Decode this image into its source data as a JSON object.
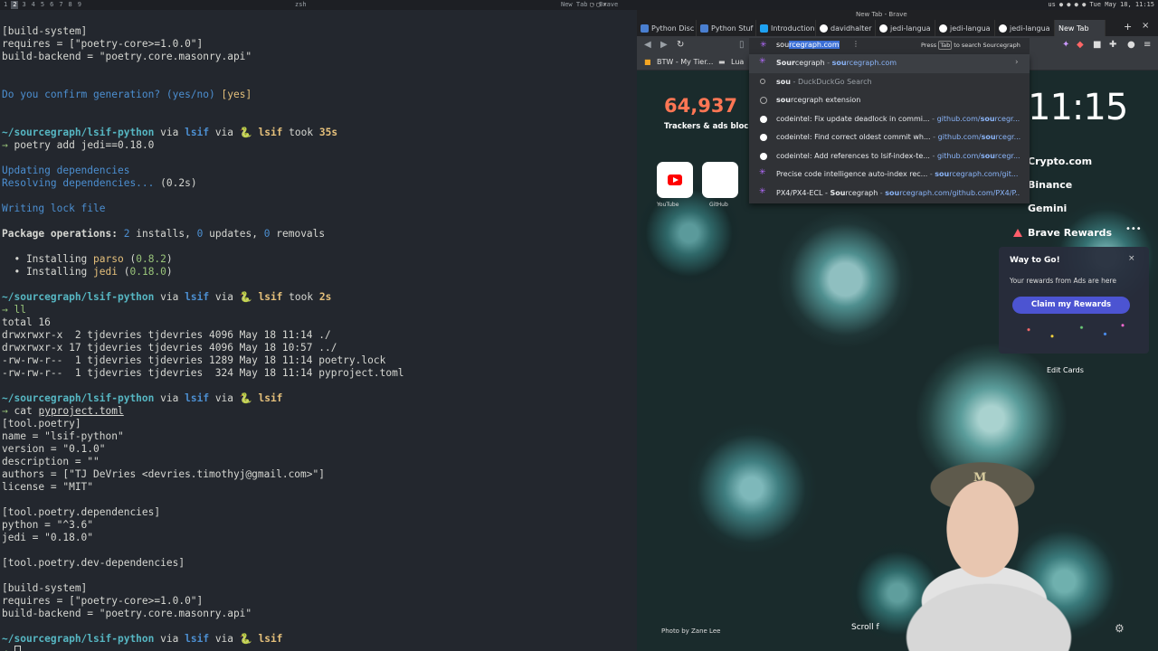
{
  "topbar": {
    "workspaces": [
      "1",
      "2",
      "3",
      "4",
      "5",
      "6",
      "7",
      "8",
      "9"
    ],
    "active_workspace": "2",
    "terminal_title": "zsh",
    "browser_window_title": "New Tab - Brave",
    "tray_region": "us",
    "datetime": "Tue May 18, 11:15"
  },
  "terminal": {
    "prompt": {
      "path": "~/sourcegraph/lsif-python",
      "via": "via",
      "branch_word": "lsif",
      "env_icon": "🐍",
      "env_name": "lsif"
    },
    "lines": [
      "[build-system]",
      "requires = [\"poetry-core>=1.0.0\"]",
      "build-backend = \"poetry.core.masonry.api\"",
      "",
      "",
      "Do you confirm generation? (yes/no) [yes]",
      "",
      "",
      "",
      "poetry add jedi==0.18.0",
      "",
      "Updating dependencies",
      "Resolving dependencies... (0.2s)",
      "",
      "Writing lock file",
      "",
      "Package operations: 2 installs, 0 updates, 0 removals",
      "",
      "  • Installing parso (0.8.2)",
      "  • Installing jedi (0.18.0)",
      "",
      "",
      "ll",
      "total 16",
      "drwxrwxr-x  2 tjdevries tjdevries 4096 May 18 11:14 ./",
      "drwxrwxr-x 17 tjdevries tjdevries 4096 May 18 10:57 ../",
      "-rw-rw-r--  1 tjdevries tjdevries 1289 May 18 11:14 poetry.lock",
      "-rw-rw-r--  1 tjdevries tjdevries  324 May 18 11:14 pyproject.toml",
      "",
      "",
      "cat pyproject.toml",
      "[tool.poetry]",
      "name = \"lsif-python\"",
      "version = \"0.1.0\"",
      "description = \"\"",
      "authors = [\"TJ DeVries <devries.timothyj@gmail.com>\"]",
      "license = \"MIT\"",
      "",
      "[tool.poetry.dependencies]",
      "python = \"^3.6\"",
      "jedi = \"0.18.0\"",
      "",
      "[tool.poetry.dev-dependencies]",
      "",
      "[build-system]",
      "requires = [\"poetry-core>=1.0.0\"]",
      "build-backend = \"poetry.core.masonry.api\"",
      "",
      ""
    ],
    "prompt1_took": "took",
    "prompt1_duration": "35s",
    "prompt2_took": "took",
    "prompt2_duration": "2s",
    "arrow": "→",
    "confirm_q": "Do you confirm generation? (yes/no)",
    "confirm_a": "[yes]",
    "cmd_poetry": "poetry add jedi==0.18.0",
    "updating": "Updating dependencies",
    "resolving": "Resolving dependencies...",
    "resolving_time": "(0.2s)",
    "writing": "Writing lock file",
    "pkg_ops_label": "Package operations:",
    "pkg_installs_n": "2",
    "pkg_installs_word": "installs,",
    "pkg_updates_n": "0",
    "pkg_updates_word": "updates,",
    "pkg_removals_n": "0",
    "pkg_removals_word": "removals",
    "install1_prefix": "  • Installing",
    "install1_pkg": "parso",
    "install1_ver": "0.8.2",
    "install2_prefix": "  • Installing",
    "install2_pkg": "jedi",
    "install2_ver": "0.18.0",
    "cmd_ll": "ll",
    "cmd_cat": "cat",
    "cat_file": "pyproject.toml"
  },
  "browser": {
    "tabs": [
      {
        "label": "Python Disc",
        "icon": "python-icon"
      },
      {
        "label": "Python Stuf",
        "icon": "python-icon"
      },
      {
        "label": "Introduction",
        "icon": "mdn-icon"
      },
      {
        "label": "davidhalter",
        "icon": "github-icon"
      },
      {
        "label": "jedi-langua",
        "icon": "github-icon"
      },
      {
        "label": "jedi-langua",
        "icon": "github-icon"
      },
      {
        "label": "jedi-langua",
        "icon": "github-icon"
      },
      {
        "label": "New Tab",
        "icon": "brave-icon",
        "active": true
      }
    ],
    "new_tab_symbol": "+",
    "close_symbol": "×",
    "bookmarks": [
      {
        "label": "BTW - My Tier..."
      },
      {
        "label": "Lua"
      }
    ],
    "omnibox": {
      "typed": "sou",
      "autocomplete": "rcegraph.com",
      "hint_prefix": "Press",
      "hint_key": "Tab",
      "hint_suffix": "to search Sourcegraph",
      "suggestions": [
        {
          "icon": "sourcegraph-icon",
          "bold": "Sour",
          "text": "cegraph",
          "sep": " - ",
          "url_bold": "sou",
          "url": "rcegraph.com",
          "highlighted": true,
          "arrow": "›"
        },
        {
          "icon": "search-icon",
          "bold": "sou",
          "text": "",
          "sep": " - ",
          "muted": "DuckDuckGo Search"
        },
        {
          "icon": "clock-icon",
          "bold": "sou",
          "text": "rcegraph extension",
          "sep": "",
          "url": ""
        },
        {
          "icon": "github-icon",
          "text": "codeintel: Fix update deadlock in commi...",
          "sep": " - ",
          "url_pre": "github.com/",
          "url_bold": "sou",
          "url": "rcegr..."
        },
        {
          "icon": "github-icon",
          "text": "codeintel: Find correct oldest commit wh...",
          "sep": " - ",
          "url_pre": "github.com/",
          "url_bold": "sou",
          "url": "rcegr..."
        },
        {
          "icon": "github-icon",
          "text": "codeintel: Add references to lsif-index-te...",
          "sep": " - ",
          "url_pre": "github.com/",
          "url_bold": "sou",
          "url": "rcegr..."
        },
        {
          "icon": "sourcegraph-icon",
          "text": "Precise code intelligence auto-index rec...",
          "sep": " - ",
          "url_bold": "sou",
          "url": "rcegraph.com/git..."
        },
        {
          "icon": "sourcegraph-icon",
          "text_pre": "PX4/PX4-ECL - ",
          "bold": "Sou",
          "text": "rcegraph",
          "sep": " - ",
          "url_bold": "sou",
          "url": "rcegraph.com/github.com/PX4/P..."
        }
      ]
    },
    "newtab": {
      "tracker_count": "64,937",
      "tracker_label": "Trackers & ads blocked",
      "clock": "11:15",
      "top_sites": [
        {
          "label": "YouTube"
        },
        {
          "label": "GitHub"
        }
      ],
      "crypto_widgets": [
        "Crypto.com",
        "Binance",
        "Gemini"
      ],
      "rewards_title": "Brave Rewards",
      "rewards_menu": "•••",
      "card_title": "Way to Go!",
      "card_close": "×",
      "card_text": "Your rewards from Ads are here",
      "claim_button": "Claim my Rewards",
      "edit_cards": "Edit Cards",
      "photo_credit": "Photo by Zane Lee",
      "scroll_hint": "Scroll f"
    }
  },
  "webcam": {
    "cap_logo": "M"
  }
}
